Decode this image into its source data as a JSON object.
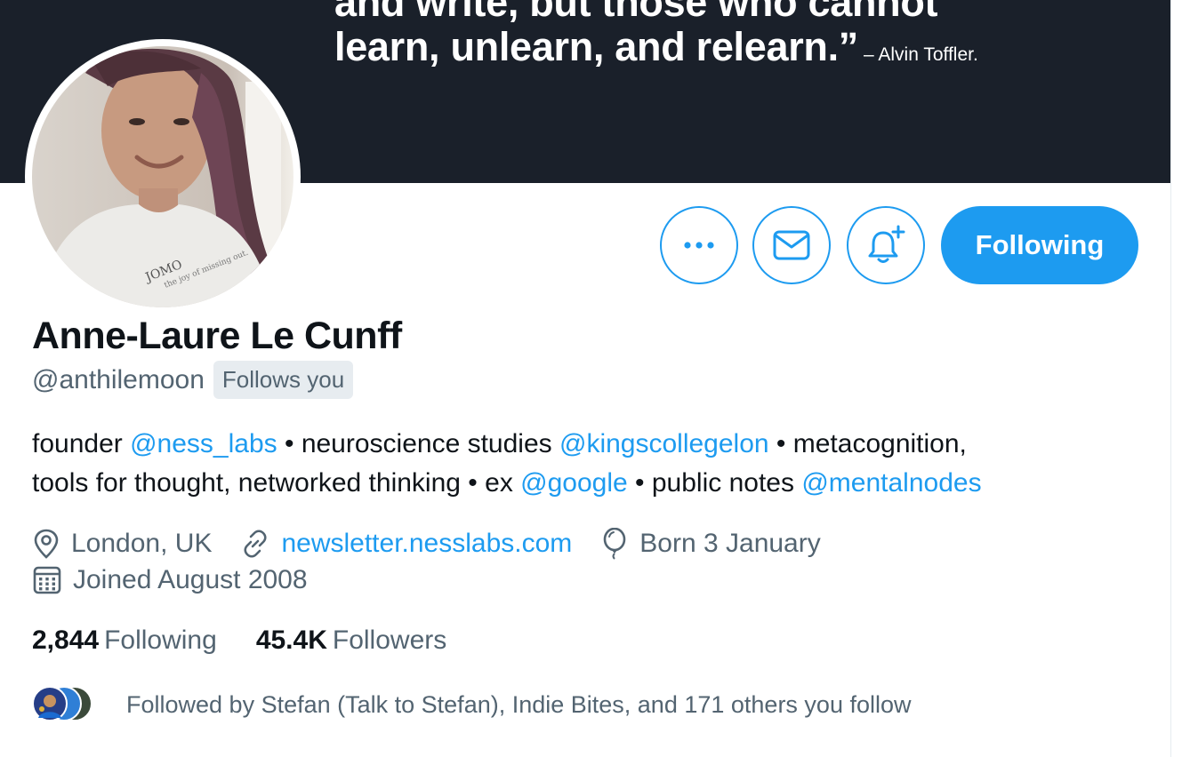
{
  "banner": {
    "quote_line1": "and write, but those who cannot",
    "quote_line2": "learn, unlearn, and relearn.”",
    "author": "– Alvin Toffler."
  },
  "avatar": {
    "shirt_text": "JOMO",
    "shirt_subtext": "the joy of missing out."
  },
  "actions": {
    "more_icon": "more-horizontal-icon",
    "message_icon": "envelope-icon",
    "notify_icon": "bell-plus-icon",
    "following_label": "Following"
  },
  "profile": {
    "name": "Anne-Laure Le Cunff",
    "handle": "@anthilemoon",
    "follows_you": "Follows you"
  },
  "bio": {
    "line1": [
      {
        "text": "founder ",
        "link": false
      },
      {
        "text": "@ness_labs",
        "link": true
      },
      {
        "text": " • neuroscience studies ",
        "link": false
      },
      {
        "text": "@kingscollegelon",
        "link": true
      },
      {
        "text": " • metacognition,",
        "link": false
      }
    ],
    "line2": [
      {
        "text": "tools for thought, networked thinking • ex ",
        "link": false
      },
      {
        "text": "@google",
        "link": true
      },
      {
        "text": " • public notes ",
        "link": false
      },
      {
        "text": "@mentalnodes",
        "link": true
      }
    ]
  },
  "meta": {
    "location": "London, UK",
    "website": "newsletter.nesslabs.com",
    "birthday": "Born 3 January",
    "joined": "Joined August 2008"
  },
  "stats": {
    "following_count": "2,844",
    "following_label": "Following",
    "followers_count": "45.4K",
    "followers_label": "Followers"
  },
  "followed_by": {
    "text": "Followed by Stefan (Talk to Stefan), Indie Bites, and 171 others you follow"
  },
  "colors": {
    "accent": "#1d9bf0",
    "banner": "#1a202a",
    "secondary_text": "#536471"
  }
}
